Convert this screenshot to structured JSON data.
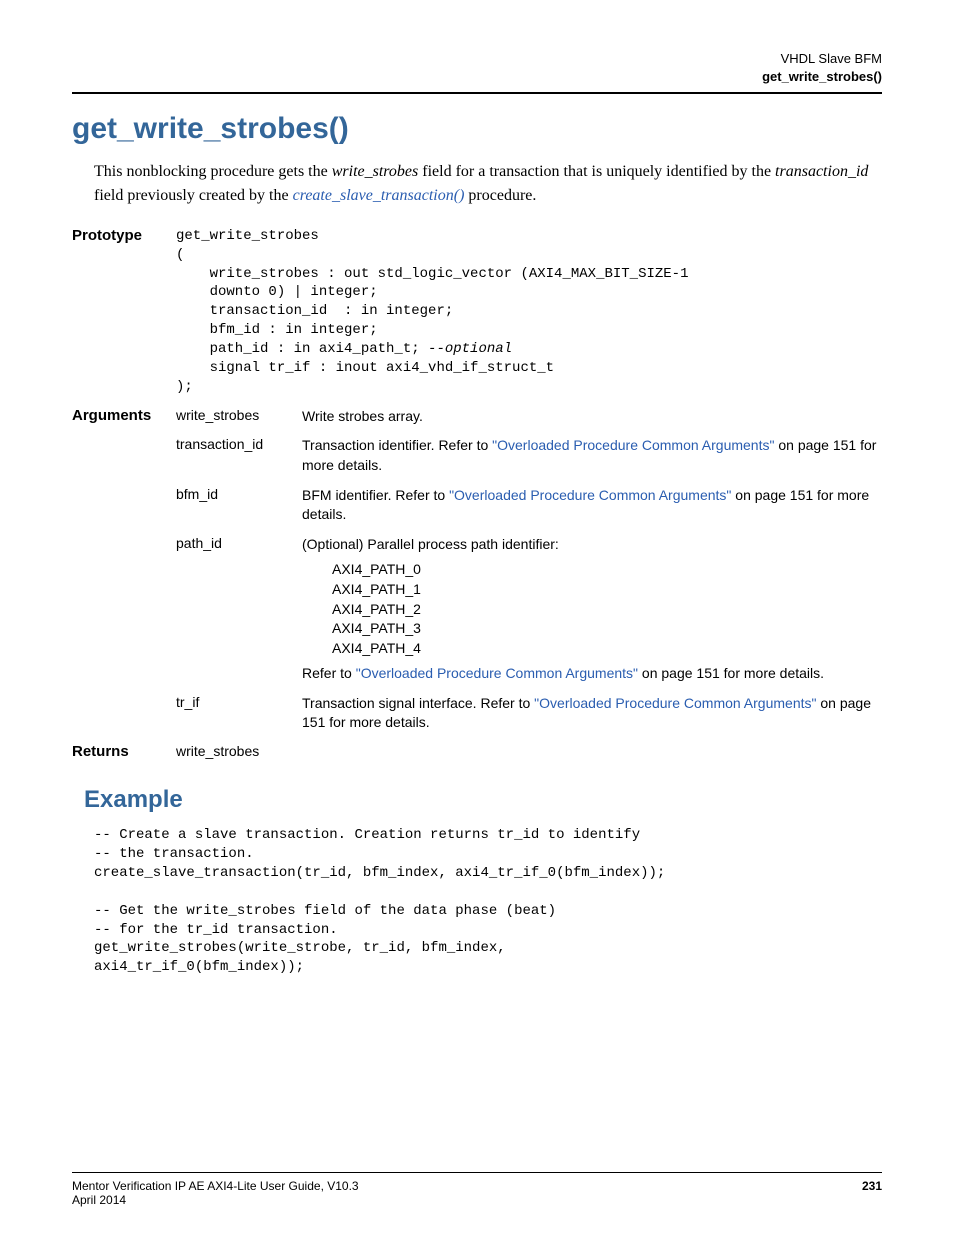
{
  "header": {
    "chapter": "VHDL Slave BFM",
    "section": "get_write_strobes()"
  },
  "title": "get_write_strobes()",
  "intro": {
    "part1": "This nonblocking procedure gets the ",
    "em1": "write_strobes",
    "part2": " field for a transaction that is uniquely identified by the ",
    "em2": "transaction_id",
    "part3": " field previously created by the ",
    "link": "create_slave_transaction()",
    "part4": " procedure."
  },
  "prototype": {
    "label": "Prototype",
    "code_l1": "get_write_strobes",
    "code_l2": "(",
    "code_l3": "    write_strobes : out std_logic_vector (AXI4_MAX_BIT_SIZE-1",
    "code_l4": "    downto 0) | integer;",
    "code_l5": "    transaction_id  : in integer;",
    "code_l6": "    bfm_id : in integer;",
    "code_l7a": "    path_id : in axi4_path_t; ",
    "code_l7b": "--optional",
    "code_l8": "    signal tr_if : inout axi4_vhd_if_struct_t",
    "code_l9": ");"
  },
  "arguments": {
    "label": "Arguments",
    "rows": {
      "r1": {
        "name": "write_strobes",
        "desc": "Write strobes array."
      },
      "r2": {
        "name": "transaction_id",
        "pre": "Transaction identifier. Refer to ",
        "link": "Overloaded Procedure Common Arguments",
        "post": " on page 151 for more details."
      },
      "r3": {
        "name": "bfm_id",
        "pre": "BFM identifier. Refer to ",
        "link": "Overloaded Procedure Common Arguments",
        "post": " on page 151 for more details."
      },
      "r4": {
        "name": "path_id",
        "desc": "(Optional) Parallel process path identifier:",
        "paths": {
          "p0": "AXI4_PATH_0",
          "p1": "AXI4_PATH_1",
          "p2": "AXI4_PATH_2",
          "p3": "AXI4_PATH_3",
          "p4": "AXI4_PATH_4"
        },
        "pre2": "Refer to ",
        "link2": "Overloaded Procedure Common Arguments",
        "post2": " on page 151 for more details."
      },
      "r5": {
        "name": "tr_if",
        "pre": "Transaction signal interface. Refer to ",
        "link": "Overloaded Procedure Common Arguments",
        "post": " on page 151 for more details."
      }
    }
  },
  "returns": {
    "label": "Returns",
    "value": "write_strobes"
  },
  "example": {
    "heading": "Example",
    "l1": "-- Create a slave transaction. Creation returns tr_id to identify",
    "l2": "-- the transaction.",
    "l3": "create_slave_transaction(tr_id, bfm_index, axi4_tr_if_0(bfm_index));",
    "l4": "",
    "l5": "-- Get the write_strobes field of the data phase (beat)",
    "l6": "-- for the tr_id transaction.",
    "l7": "get_write_strobes(write_strobe, tr_id, bfm_index,",
    "l8": "axi4_tr_if_0(bfm_index));"
  },
  "footer": {
    "left1": "Mentor Verification IP AE AXI4-Lite User Guide, V10.3",
    "left2": "April 2014",
    "page": "231"
  }
}
